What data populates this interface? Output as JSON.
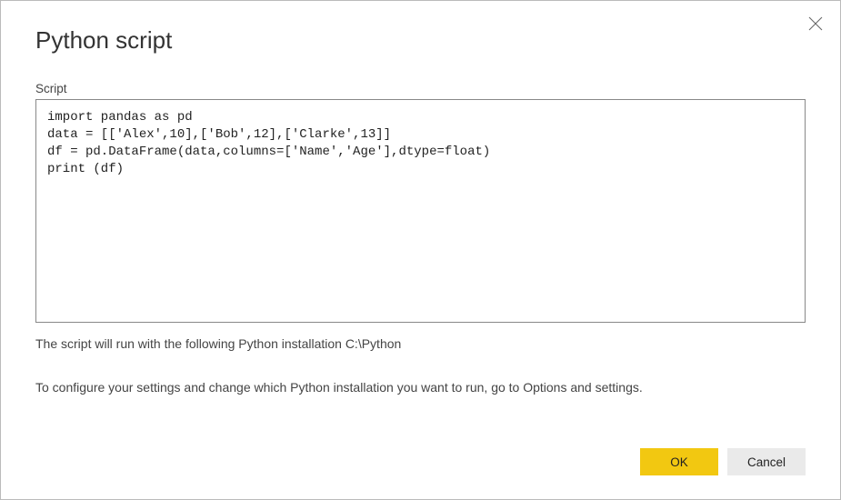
{
  "dialog": {
    "title": "Python script",
    "field_label": "Script",
    "script_content": "import pandas as pd\ndata = [['Alex',10],['Bob',12],['Clarke',13]]\ndf = pd.DataFrame(data,columns=['Name','Age'],dtype=float)\nprint (df)",
    "hint_install_path": "The script will run with the following Python installation C:\\Python",
    "hint_configure": "To configure your settings and change which Python installation you want to run, go to Options and settings.",
    "ok_label": "OK",
    "cancel_label": "Cancel"
  }
}
